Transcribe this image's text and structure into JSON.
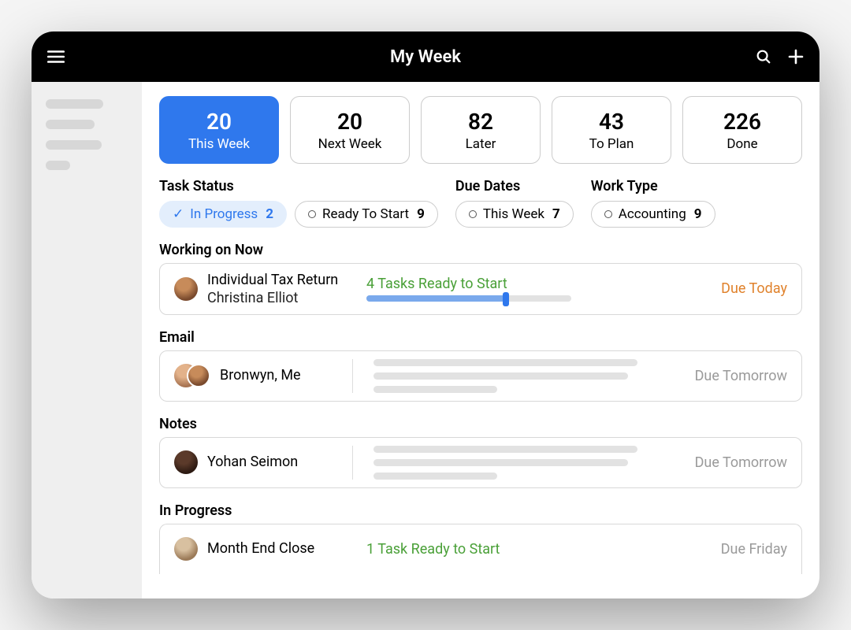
{
  "header": {
    "title": "My Week"
  },
  "summary": [
    {
      "count": "20",
      "label": "This Week",
      "active": true
    },
    {
      "count": "20",
      "label": "Next Week",
      "active": false
    },
    {
      "count": "82",
      "label": "Later",
      "active": false
    },
    {
      "count": "43",
      "label": "To Plan",
      "active": false
    },
    {
      "count": "226",
      "label": "Done",
      "active": false
    }
  ],
  "filters": {
    "status_label": "Task Status",
    "dates_label": "Due Dates",
    "type_label": "Work Type",
    "chips": {
      "in_progress": {
        "label": "In Progress",
        "count": "2"
      },
      "ready": {
        "label": "Ready To Start",
        "count": "9"
      },
      "this_week": {
        "label": "This Week",
        "count": "7"
      },
      "accounting": {
        "label": "Accounting",
        "count": "9"
      }
    }
  },
  "sections": {
    "working": {
      "label": "Working on Now",
      "item": {
        "title": "Individual Tax Return",
        "subtitle": "Christina Elliot",
        "ready": "4 Tasks Ready to Start",
        "due": "Due Today",
        "progress_pct": 68
      }
    },
    "email": {
      "label": "Email",
      "item": {
        "title": "Bronwyn, Me",
        "due": "Due Tomorrow"
      }
    },
    "notes": {
      "label": "Notes",
      "item": {
        "title": "Yohan Seimon",
        "due": "Due Tomorrow"
      }
    },
    "in_progress": {
      "label": "In Progress",
      "item": {
        "title": "Month End Close",
        "ready": "1 Task Ready to Start",
        "due": "Due Friday"
      }
    }
  }
}
